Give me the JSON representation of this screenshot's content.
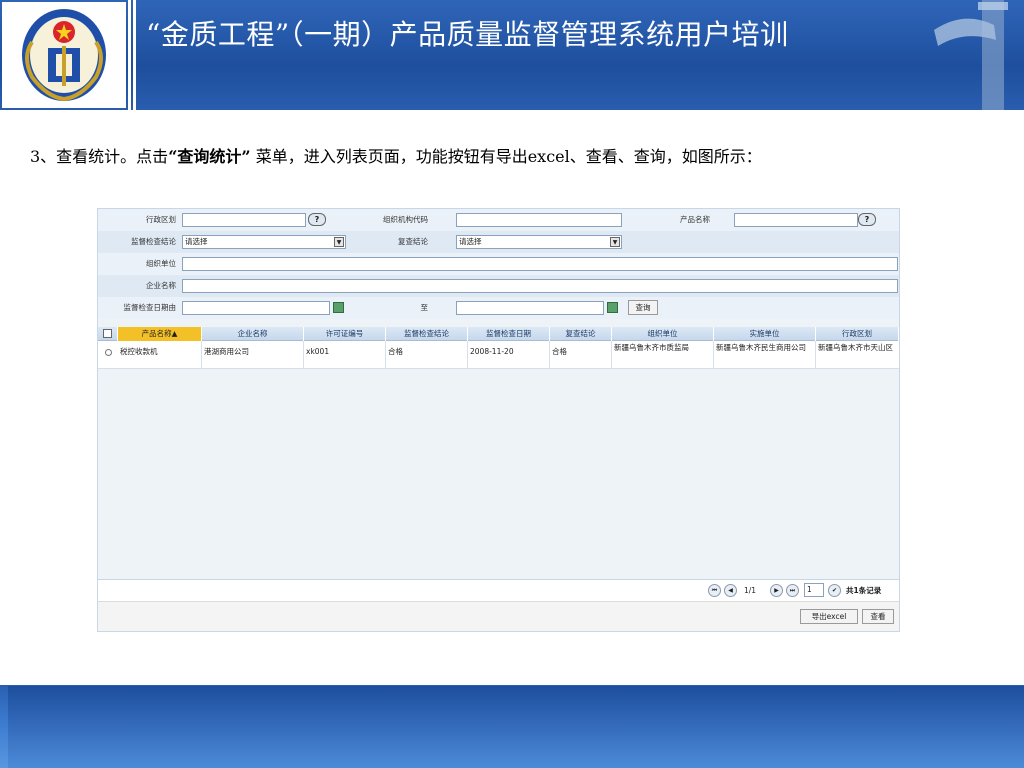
{
  "slide": {
    "title": "“金质工程”（一期）产品质量监督管理系统用户培训",
    "body_prefix": "3、查看统计。点击",
    "body_bold": "“查询统计”",
    "body_suffix": " 菜单，进入列表页面，功能按钮有导出excel、查看、查询，如图所示："
  },
  "colors": {
    "header_blue": "#1e4f9e",
    "panel_bg": "#eef3f8",
    "sorted_header": "#f4c028"
  },
  "form": {
    "region_label": "行政区划",
    "org_code_label": "组织机构代码",
    "product_name_label": "产品名称",
    "inspect_result_label": "监督检查结论",
    "inspect_result_value": "请选择",
    "recheck_result_label": "复查结论",
    "recheck_result_value": "请选择",
    "org_unit_label": "组织单位",
    "company_label": "企业名称",
    "date_from_label": "监督检查日期由",
    "date_to_label": "至",
    "query_button": "查询",
    "help_icon": "?"
  },
  "table": {
    "headers": [
      "产品名称▲",
      "企业名称",
      "许可证编号",
      "监督检查结论",
      "监督检查日期",
      "复查结论",
      "组织单位",
      "实施单位",
      "行政区划"
    ],
    "rows": [
      [
        "税控收款机",
        "港湖商用公司",
        "xk001",
        "合格",
        "2008-11-20",
        "合格",
        "新疆乌鲁木齐市质监局",
        "新疆乌鲁木齐民生商用公司",
        "新疆乌鲁木齐市天山区"
      ]
    ]
  },
  "pager": {
    "page_info": "1/1",
    "page_input": "1",
    "total_text": "共1条记录"
  },
  "actions": {
    "export_label": "导出excel",
    "view_label": "查看"
  }
}
